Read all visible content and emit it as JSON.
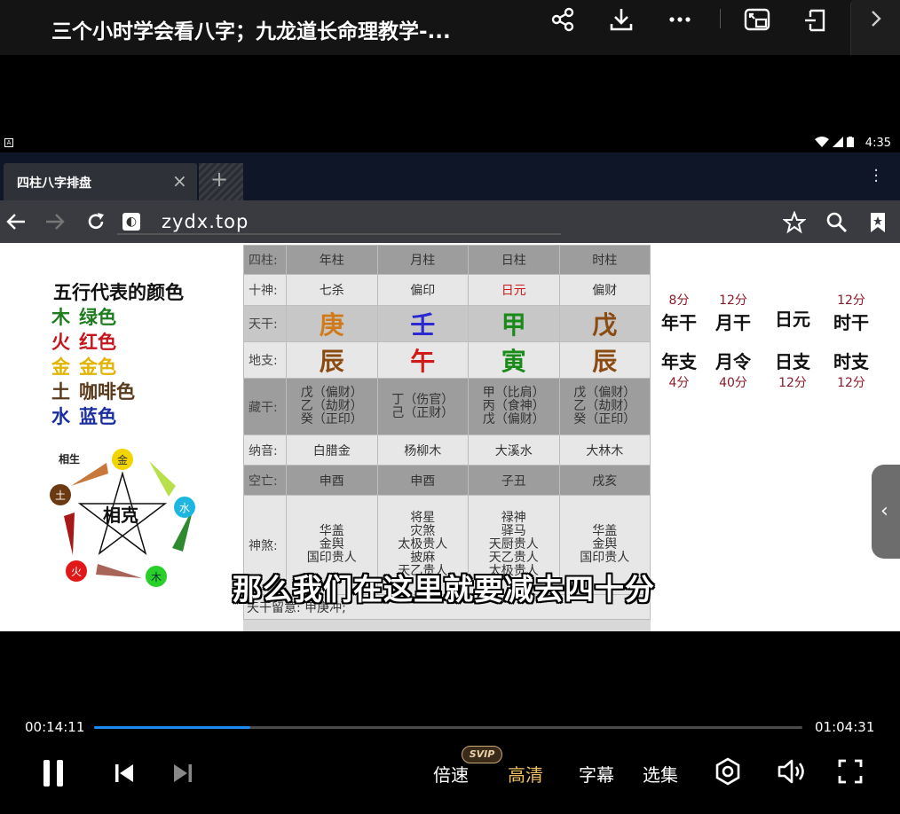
{
  "top": {
    "title": "三个小时学会看八字；九龙道长命理教学-..."
  },
  "status": {
    "time": "4:35"
  },
  "browser": {
    "tab_label": "四柱八字排盘",
    "tab_close": "×",
    "new_tab": "+",
    "url": "zydx.top"
  },
  "legend": {
    "title": "五行代表的颜色",
    "rows": [
      {
        "el": "木",
        "name": "绿色",
        "color": "#1e7d1e"
      },
      {
        "el": "火",
        "name": "红色",
        "color": "#c4161c"
      },
      {
        "el": "金",
        "name": "金色",
        "color": "#e0b400"
      },
      {
        "el": "土",
        "name": "咖啡色",
        "color": "#5a3a1a"
      },
      {
        "el": "水",
        "name": "蓝色",
        "color": "#1a2ea0"
      }
    ],
    "cycle": {
      "sheng": "相生",
      "ke": "相克",
      "nodes": {
        "jin": "金",
        "shui": "水",
        "mu": "木",
        "huo": "火",
        "tu": "土"
      }
    }
  },
  "table": {
    "header": {
      "label": "四柱:",
      "cols": [
        "年柱",
        "月柱",
        "日柱",
        "时柱"
      ]
    },
    "shishen": {
      "label": "十神:",
      "cols": [
        "七杀",
        "偏印",
        "日元",
        "偏财"
      ]
    },
    "tiangan": {
      "label": "天干:",
      "cols": [
        "庚",
        "壬",
        "甲",
        "戊"
      ]
    },
    "dizhi": {
      "label": "地支:",
      "cols": [
        "辰",
        "午",
        "寅",
        "辰"
      ]
    },
    "canggan": {
      "label": "藏干:",
      "cols": [
        [
          "戊（偏财）",
          "乙（劫财）",
          "癸（正印）"
        ],
        [
          "丁（伤官）",
          "己（正财）"
        ],
        [
          "甲（比肩）",
          "丙（食神）",
          "戊（偏财）"
        ],
        [
          "戊（偏财）",
          "乙（劫财）",
          "癸（正印）"
        ]
      ]
    },
    "nayin": {
      "label": "纳音:",
      "cols": [
        "白腊金",
        "杨柳木",
        "大溪水",
        "大林木"
      ]
    },
    "kongwang": {
      "label": "空亡:",
      "cols": [
        "申酉",
        "申酉",
        "子丑",
        "戌亥"
      ]
    },
    "shensha": {
      "label": "神煞:",
      "cols": [
        [
          "华盖",
          "金舆",
          "国印贵人"
        ],
        [
          "将星",
          "灾煞",
          "太极贵人",
          "披麻",
          "天乙贵人"
        ],
        [
          "禄神",
          "驿马",
          "天厨贵人",
          "天乙贵人",
          "太极贵人"
        ],
        [
          "华盖",
          "金舆",
          "国印贵人"
        ]
      ]
    },
    "note": "天干留意: 甲庚冲;"
  },
  "scores": {
    "top": [
      {
        "num": "8分",
        "label": "年干"
      },
      {
        "num": "12分",
        "label": "月干"
      },
      {
        "num": "",
        "label": "日元"
      },
      {
        "num": "12分",
        "label": "时干"
      }
    ],
    "bottom": [
      {
        "num": "4分",
        "label": "年支"
      },
      {
        "num": "40分",
        "label": "月令"
      },
      {
        "num": "12分",
        "label": "日支"
      },
      {
        "num": "12分",
        "label": "时支"
      }
    ]
  },
  "subtitle": "那么我们在这里就要减去四十分",
  "player": {
    "current_time": "00:14:11",
    "total_time": "01:04:31",
    "progress": 0.22,
    "speed": "倍速",
    "svip": "SVIP",
    "quality": "高清",
    "captions": "字幕",
    "episodes": "选集",
    "accent": "#1d8cf0",
    "quality_color": "#f0c060"
  },
  "colors": {
    "tg_geng": "#d07a1a",
    "tg_ren": "#2a2ad0",
    "tg_jia": "#1a8a1a",
    "tg_wu": "#8a4a10",
    "dz_chen": "#8a4a10",
    "dz_wu": "#d01a1a",
    "dz_yin": "#1a8a1a",
    "riyuan": "#d01a1a"
  }
}
